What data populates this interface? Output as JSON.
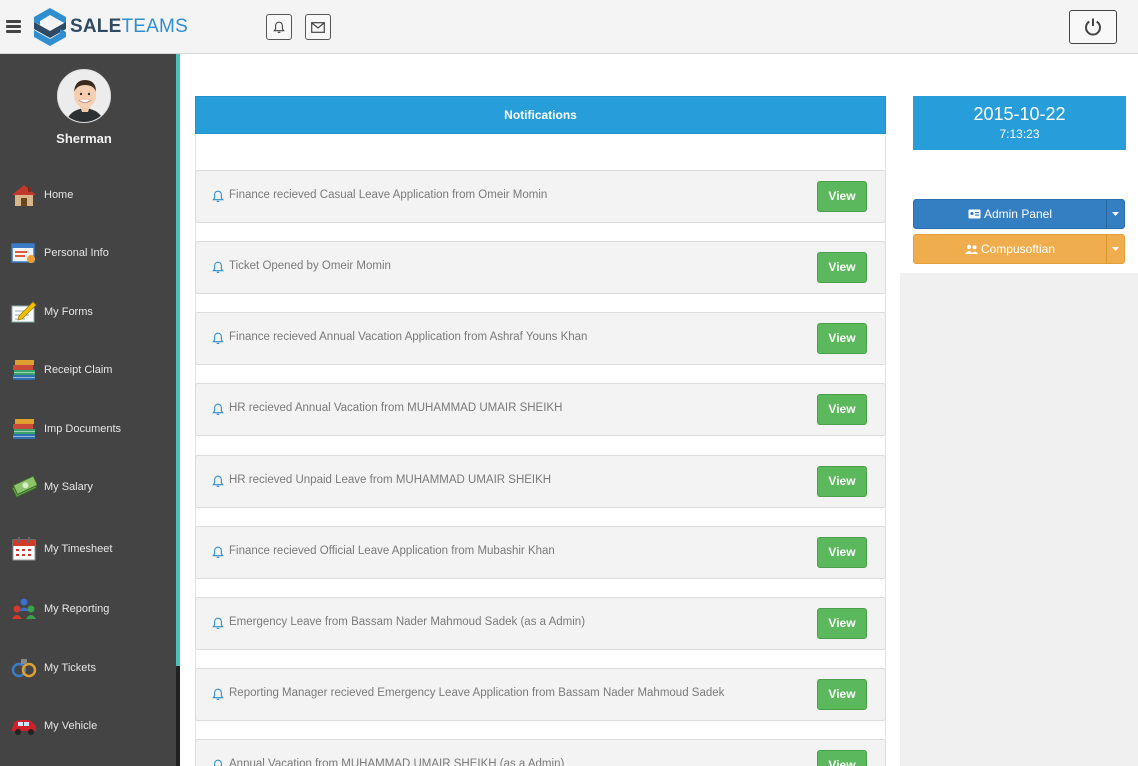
{
  "app": {
    "logo_text_a": "SALE",
    "logo_text_b": "TEAMS"
  },
  "topbar": {
    "icons": [
      "menu-icon",
      "bell-icon",
      "envelope-icon",
      "power-icon"
    ]
  },
  "user": {
    "name": "Sherman"
  },
  "sidebar": {
    "items": [
      {
        "label": "Home",
        "icon": "home-icon"
      },
      {
        "label": "Personal Info",
        "icon": "id-card-icon"
      },
      {
        "label": "My Forms",
        "icon": "form-icon"
      },
      {
        "label": "Receipt Claim",
        "icon": "books-icon"
      },
      {
        "label": "Imp Documents",
        "icon": "books-icon"
      },
      {
        "label": "My Salary",
        "icon": "money-icon"
      },
      {
        "label": "My Timesheet",
        "icon": "calendar-icon"
      },
      {
        "label": "My Reporting",
        "icon": "people-icon"
      },
      {
        "label": "My Tickets",
        "icon": "tickets-icon"
      },
      {
        "label": "My Vehicle",
        "icon": "car-icon"
      }
    ]
  },
  "notifications": {
    "title": "Notifications",
    "view_label": "View",
    "items": [
      "Finance recieved Casual Leave Application from Omeir Momin",
      "Ticket Opened by Omeir Momin",
      "Finance recieved Annual Vacation Application from Ashraf Youns Khan",
      "HR recieved Annual Vacation from MUHAMMAD UMAIR SHEIKH",
      "HR recieved Unpaid Leave from MUHAMMAD UMAIR SHEIKH",
      "Finance recieved Official Leave Application from Mubashir Khan",
      " Emergency Leave from Bassam Nader Mahmoud Sadek (as a Admin)",
      "Reporting Manager recieved Emergency Leave Application from Bassam Nader Mahmoud Sadek",
      " Annual Vacation from MUHAMMAD UMAIR SHEIKH (as a Admin)"
    ]
  },
  "datetime": {
    "date": "2015-10-22",
    "time": "7:13:23"
  },
  "actions": {
    "admin_label": "Admin Panel",
    "company_label": "Compusoftian"
  },
  "colors": {
    "primary": "#279dd9",
    "sidebar": "#444445",
    "accent": "#4dbfbd",
    "success": "#5cb85c",
    "warning": "#f0ad4e",
    "admin": "#347ec2"
  }
}
